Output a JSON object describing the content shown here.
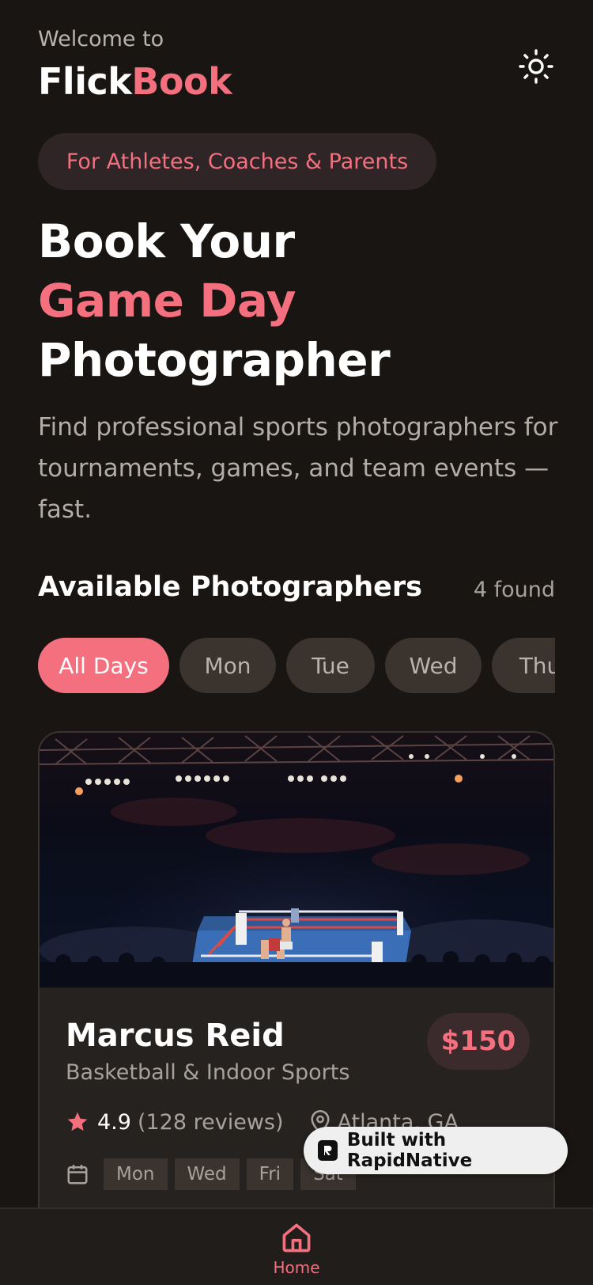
{
  "header": {
    "welcome": "Welcome to",
    "brand_part1": "Flick",
    "brand_part2": "Book",
    "theme_icon": "sun-icon"
  },
  "tagline_pill": "For Athletes, Coaches & Parents",
  "hero": {
    "line1": "Book Your",
    "line2": "Game Day",
    "line3": "Photographer"
  },
  "subtitle": "Find professional sports photographers for tournaments, games, and team events — fast.",
  "section": {
    "title": "Available Photographers",
    "count": "4 found"
  },
  "day_filters": [
    {
      "label": "All Days",
      "active": true
    },
    {
      "label": "Mon",
      "active": false
    },
    {
      "label": "Tue",
      "active": false
    },
    {
      "label": "Wed",
      "active": false
    },
    {
      "label": "Thu",
      "active": false
    }
  ],
  "photographer": {
    "name": "Marcus Reid",
    "specialty": "Basketball & Indoor Sports",
    "price": "$150",
    "rating": "4.9",
    "reviews": "(128 reviews)",
    "location": "Atlanta, GA",
    "days": [
      "Mon",
      "Wed",
      "Fri",
      "Sat"
    ]
  },
  "badge": {
    "label": "Built with RapidNative"
  },
  "tabbar": {
    "home_label": "Home"
  },
  "colors": {
    "accent": "#f4707f",
    "background": "#181512",
    "card": "#26221f",
    "chip": "#3a332e"
  }
}
